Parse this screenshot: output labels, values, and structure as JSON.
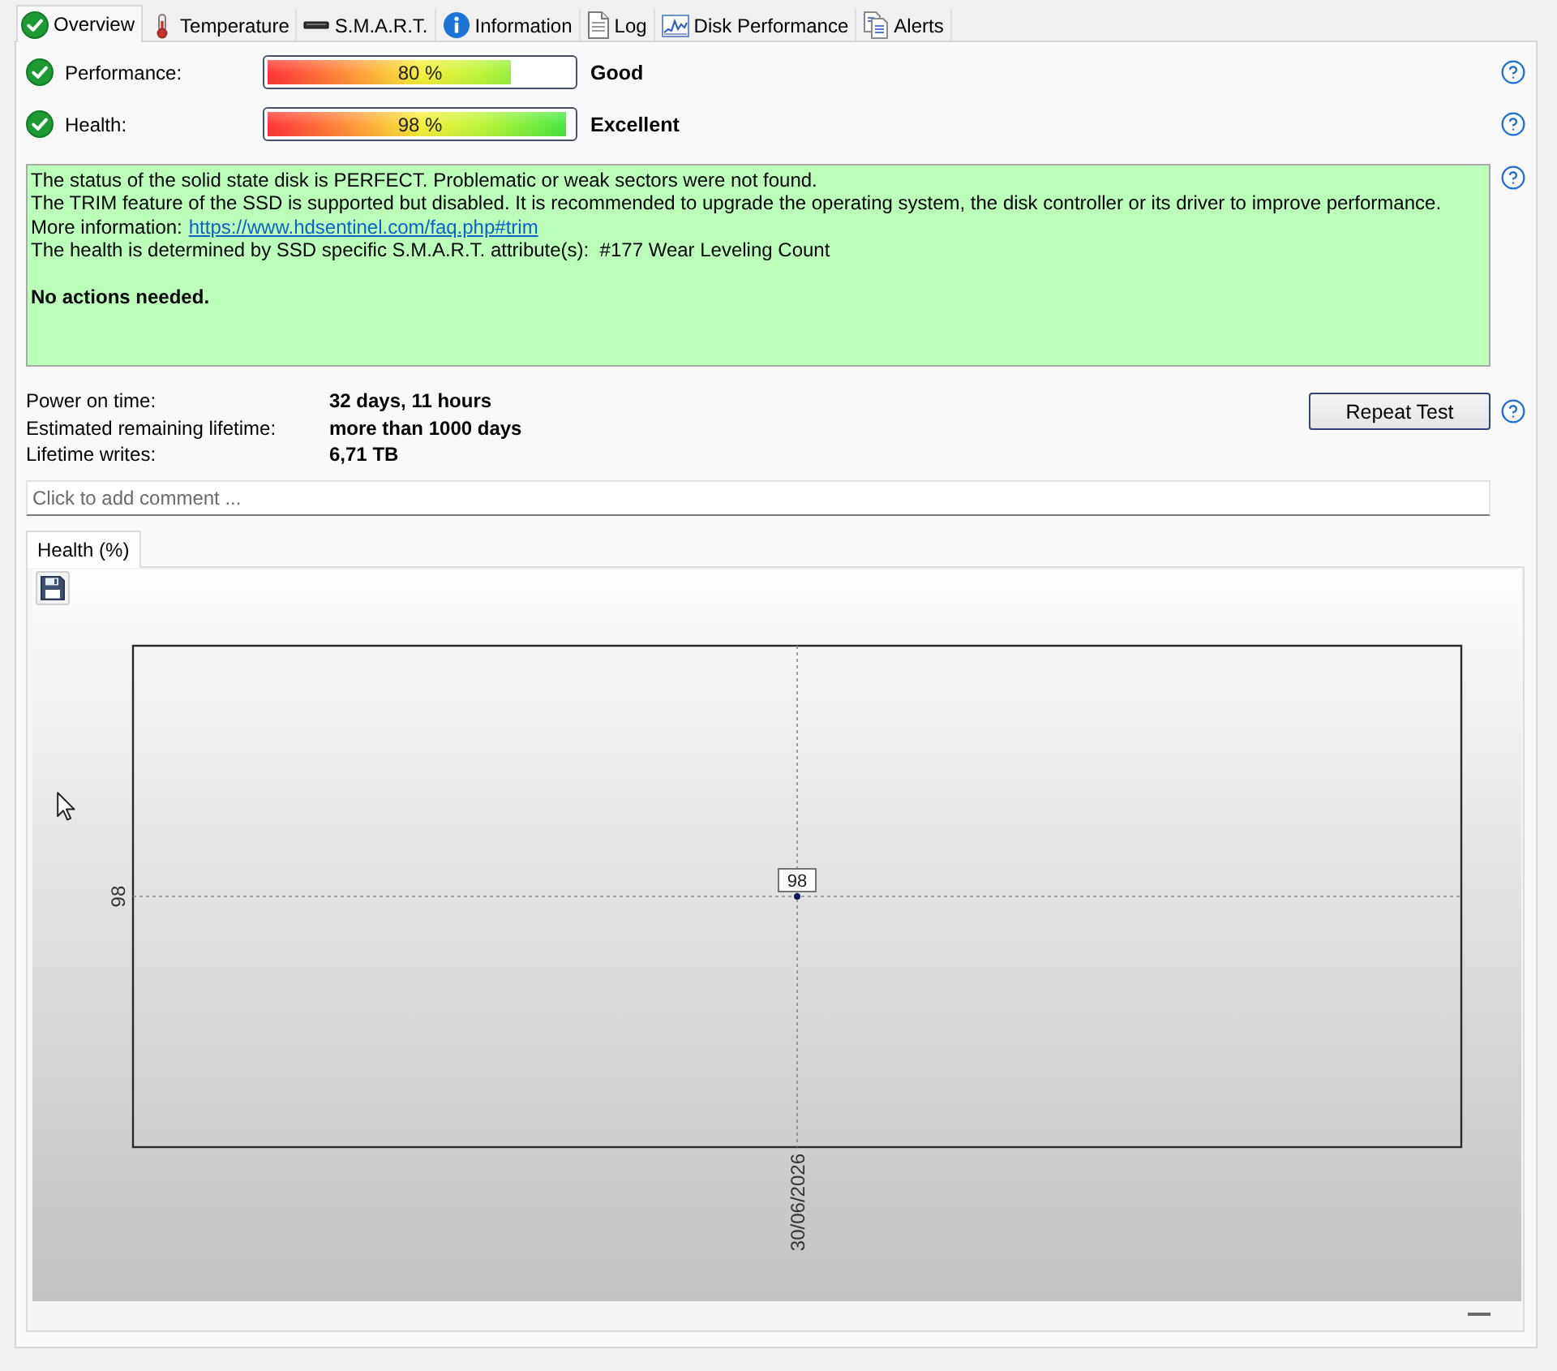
{
  "tabs": [
    {
      "label": "Overview",
      "selected": true
    },
    {
      "label": "Temperature",
      "selected": false
    },
    {
      "label": "S.M.A.R.T.",
      "selected": false
    },
    {
      "label": "Information",
      "selected": false
    },
    {
      "label": "Log",
      "selected": false
    },
    {
      "label": "Disk Performance",
      "selected": false
    },
    {
      "label": "Alerts",
      "selected": false
    }
  ],
  "status_rows": [
    {
      "label": "Performance:",
      "level": 0.8,
      "reading": "80 %",
      "rating": "Good"
    },
    {
      "label": "Health:",
      "level": 0.98,
      "reading": "98 %",
      "rating": "Excellent"
    }
  ],
  "message": {
    "lines": [
      {
        "kind": "text",
        "text": "The status of the solid state disk is PERFECT. Problematic or weak sectors were not found."
      },
      {
        "kind": "text",
        "text": "The TRIM feature of the SSD is supported but disabled. It is recommended to upgrade the operating system, the disk controller or its driver to improve performance."
      },
      {
        "kind": "link",
        "text": "More information:",
        "link": "https://www.hdsentinel.com/faq.php#trim"
      },
      {
        "kind": "text",
        "text": "The health is determined by SSD specific S.M.A.R.T. attribute(s):  #177 Wear Leveling Count"
      }
    ],
    "conclusion": "No actions needed."
  },
  "details": [
    {
      "label": "Power on time:",
      "value": "32 days, 11 hours"
    },
    {
      "label": "Estimated remaining lifetime:",
      "value": "more than 1000 days"
    },
    {
      "label": "Lifetime writes:",
      "value": "6,71 TB"
    }
  ],
  "repeat_button": "Repeat Test",
  "comment": {
    "placeholder": "Click to add comment ..."
  },
  "chart_tabs": [
    {
      "label": "Health (%)",
      "selected": true
    }
  ],
  "chart": {
    "y_tick_labels": [
      "98"
    ],
    "points": [
      {
        "date_label": "30/06/2026",
        "value_label": "98"
      }
    ]
  }
}
